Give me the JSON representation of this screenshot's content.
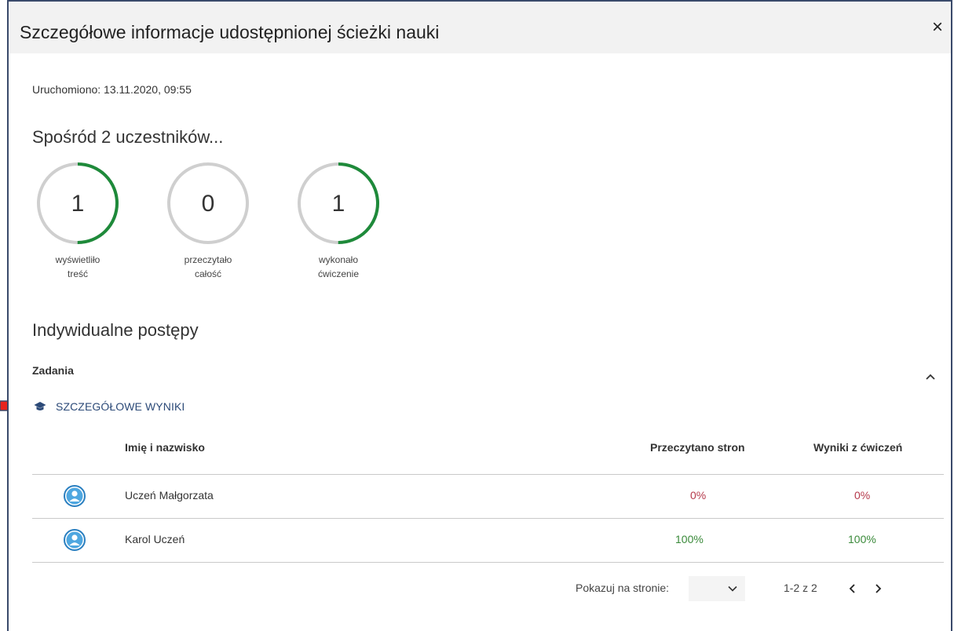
{
  "dialog": {
    "title": "Szczegółowe informacje udostępnionej ścieżki nauki",
    "close_label": "×"
  },
  "started": "Uruchomiono: 13.11.2020, 09:55",
  "summary": {
    "heading": "Spośród 2 uczestników...",
    "stats": [
      {
        "value": "1",
        "label_line1": "wyświetliło",
        "label_line2": "treść",
        "progress": 0.5
      },
      {
        "value": "0",
        "label_line1": "przeczytało",
        "label_line2": "całość",
        "progress": 0
      },
      {
        "value": "1",
        "label_line1": "wykonało",
        "label_line2": "ćwiczenie",
        "progress": 0.5
      }
    ]
  },
  "progress_section": {
    "heading": "Indywidualne postępy",
    "tasks_label": "Zadania",
    "detail_link": "SZCZEGÓŁOWE WYNIKI"
  },
  "table": {
    "columns": [
      "Imię i nazwisko",
      "Przeczytano stron",
      "Wyniki z ćwiczeń"
    ],
    "rows": [
      {
        "name": "Uczeń Małgorzata",
        "pages": "0%",
        "exercises": "0%"
      },
      {
        "name": "Karol Uczeń",
        "pages": "100%",
        "exercises": "100%"
      }
    ]
  },
  "pagination": {
    "per_page_label": "Pokazuj na stronie:",
    "range": "1-2 z 2"
  },
  "colors": {
    "ring_track": "#cfcfcf",
    "ring_progress": "#1e8a3a",
    "link": "#2c4a78",
    "pct_zero": "#b5394b",
    "pct_full": "#3a8a3a",
    "annotation_arrow": "#e8231d"
  }
}
